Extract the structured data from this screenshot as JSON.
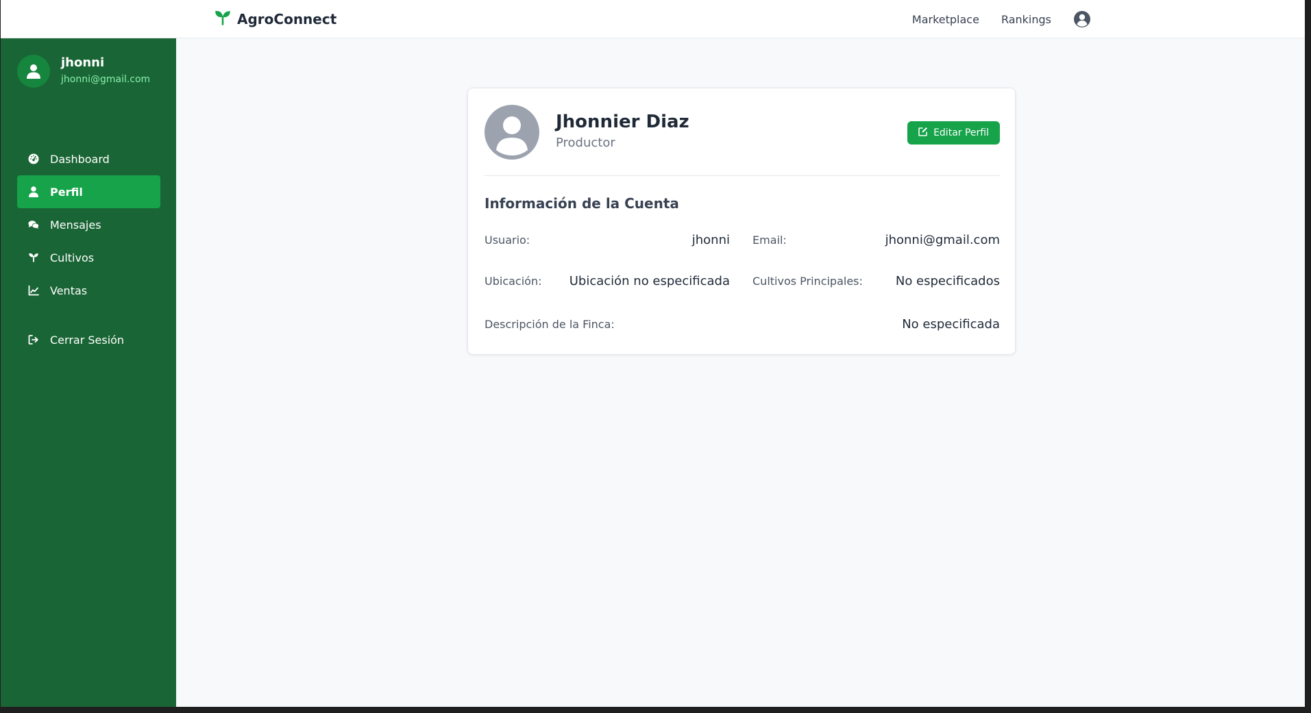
{
  "navbar": {
    "brand": "AgroConnect",
    "links": [
      "Marketplace",
      "Rankings"
    ]
  },
  "sidebar": {
    "user": {
      "name": "jhonni",
      "email": "jhonni@gmail.com"
    },
    "items": [
      {
        "label": "Dashboard",
        "icon": "dashboard-icon"
      },
      {
        "label": "Perfil",
        "icon": "user-icon",
        "active": true
      },
      {
        "label": "Mensajes",
        "icon": "comments-icon"
      },
      {
        "label": "Cultivos",
        "icon": "seedling-icon"
      },
      {
        "label": "Ventas",
        "icon": "chart-line-icon"
      }
    ],
    "logout": "Cerrar Sesión"
  },
  "profile": {
    "name": "Jhonnier Diaz",
    "role": "Productor",
    "edit_label": "Editar Perfil"
  },
  "account": {
    "title": "Información de la Cuenta",
    "fields": [
      {
        "label": "Usuario:",
        "value": "jhonni"
      },
      {
        "label": "Email:",
        "value": "jhonni@gmail.com"
      },
      {
        "label": "Ubicación:",
        "value": "Ubicación no especificada"
      },
      {
        "label": "Cultivos Principales:",
        "value": "No especificados"
      },
      {
        "label": "Descripción de la Finca:",
        "value": "No especificada"
      }
    ]
  },
  "colors": {
    "sidebar": "#1a6535",
    "accent": "#16a34a",
    "background": "#f8f9fb"
  }
}
